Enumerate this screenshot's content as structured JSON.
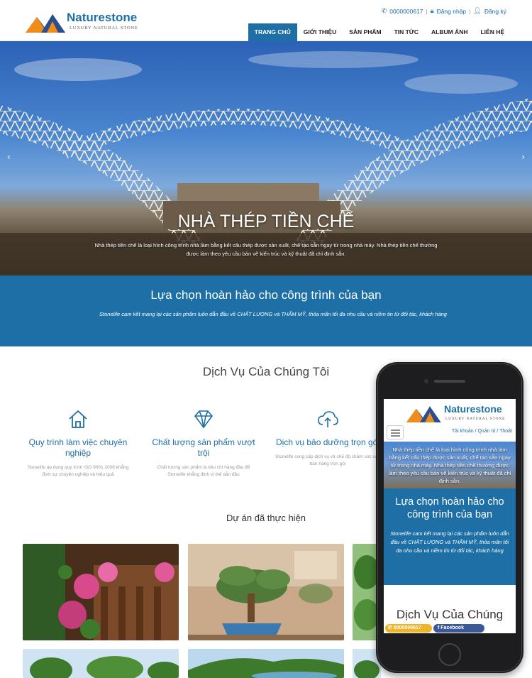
{
  "brand": {
    "name": "Naturestone",
    "tagline": "LUXURY NATURAL STONE",
    "colors": {
      "primary": "#1d6fa5",
      "accent": "#f08c1a",
      "logo_dark": "#2a4f8f"
    }
  },
  "topbar": {
    "phone": "0000000617",
    "login": "Đăng nhập",
    "register": "Đăng ký",
    "phone_icon": "phone-icon",
    "login_icon": "lock-icon",
    "register_icon": "user-plus-icon"
  },
  "nav": {
    "items": [
      {
        "label": "TRANG CHỦ",
        "active": true
      },
      {
        "label": "GIỚI THIỆU",
        "active": false
      },
      {
        "label": "SẢN PHẨM",
        "active": false
      },
      {
        "label": "TIN TỨC",
        "active": false
      },
      {
        "label": "ALBUM ẢNH",
        "active": false
      },
      {
        "label": "LIÊN HỆ",
        "active": false
      }
    ]
  },
  "hero": {
    "title": "NHÀ THÉP TIỀN CHẾ",
    "description": "Nhà thép tiền chế là loại hình công trình nhà làm bằng kết cấu thép được sản xuất, chế tạo sẵn ngay từ trong nhà máy. Nhà thép tiền chế thường được làm theo yêu cầu bản vẽ kiến trúc và kỹ thuật đã chỉ định sẵn."
  },
  "band": {
    "title": "Lựa chọn hoàn hảo cho công trình của bạn",
    "text": "Stonelife cam kết mang lại các sản phẩm luôn dẫn đầu về CHẤT LƯỢNG và THẨM MỸ, thỏa mãn tối đa nhu cầu và niềm tin từ đối tác, khách hàng"
  },
  "services": {
    "title": "Dịch Vụ Của Chúng Tôi",
    "items": [
      {
        "icon": "home-icon",
        "title": "Quy trình làm việc chuyên nghiệp",
        "desc": "Stonelife áp dụng quy trình ISO 9001:2008 khẳng định sự chuyên nghiệp và hiệu quả"
      },
      {
        "icon": "diamond-icon",
        "title": "Chất lượng sản phẩm vượt trội",
        "desc": "Chất lượng sản phẩm là tiêu chí hàng đầu để Stonelife khẳng định vị thế dẫn đầu"
      },
      {
        "icon": "cloud-upload-icon",
        "title": "Dịch vụ bảo dưỡng trọn gói",
        "desc": "Stonelife cung cấp dịch vụ và chế độ chăm sóc sau bán hàng trọn gói"
      }
    ]
  },
  "projects": {
    "title": "Dự án đã thực hiện"
  },
  "mobile": {
    "account": "Tài khoản / Quản trị / Thoát",
    "hero_text": "Nhà thép tiền chế là loại hình công trình nhà làm bằng kết cấu thép được sản xuất, chế tạo sẵn ngay từ trong nhà máy. Nhà thép tiền chế thường được làm theo yêu cầu bản vẽ kiến trúc và kỹ thuật đã chỉ định sẵn.",
    "band_title": "Lựa chọn hoàn hảo cho công trình của bạn",
    "band_text": "Stonelife cam kết mang lại các sản phẩm luôn dẫn đầu về CHẤT LƯỢNG và THẨM MỸ, thỏa mãn tối đa nhu cầu và niềm tin từ đối tác, khách hàng",
    "services_title": "Dịch Vụ Của Chúng",
    "phone_button": "0000000617",
    "facebook_button": "Facebook"
  }
}
